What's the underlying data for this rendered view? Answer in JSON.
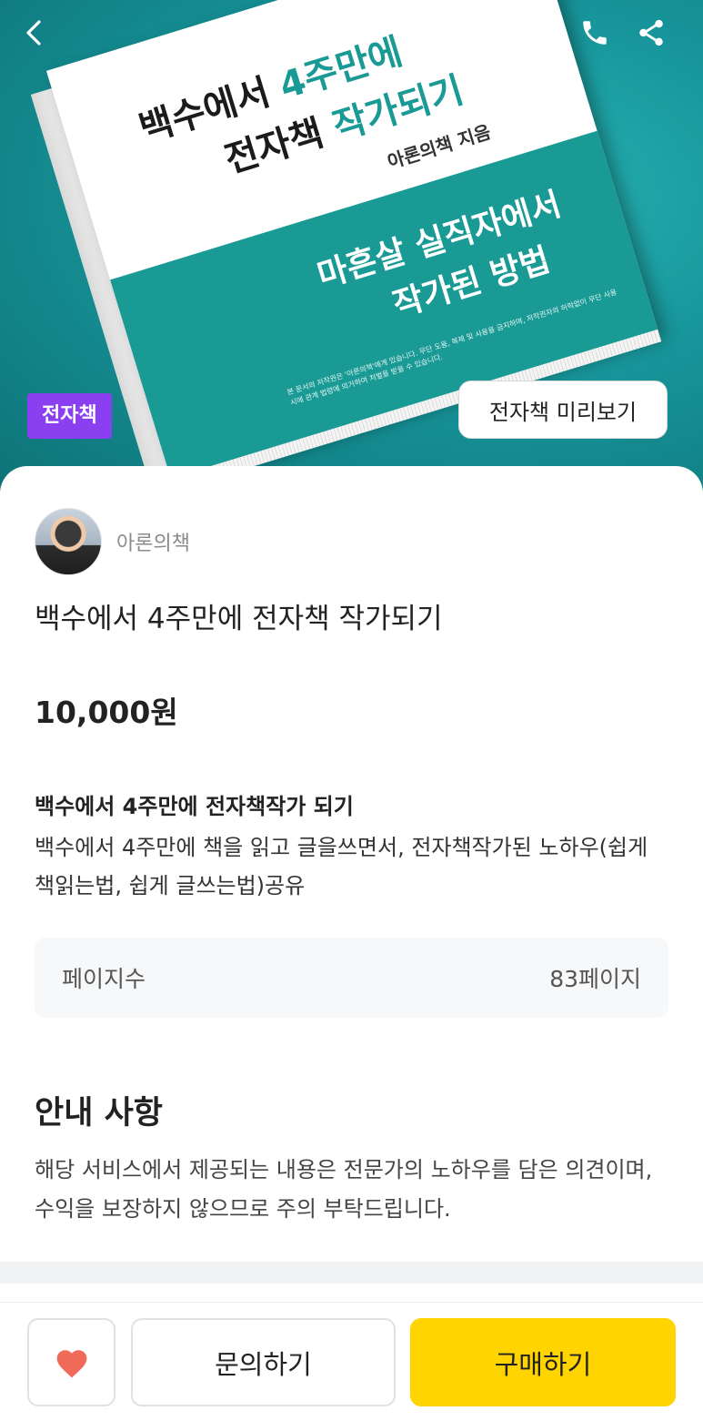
{
  "hero": {
    "cover": {
      "title_line1_prefix": "백수에서 ",
      "title_line1_highlight": "4주만에",
      "title_line2_prefix": "전자책 ",
      "title_line2_highlight": "작가되기",
      "author": "아론의책 지음",
      "subtitle_line1": "마흔살 실직자에서",
      "subtitle_line2": "작가된 방법",
      "fine_print": "본 문서의 저작권은 '아론의책'에게 있습니다. 무단 도용, 복제 및 사용을 금지하며, 저작권자의 허락없이 무단 사용 시에 관계 법령에 의거하여 처벌을 받을 수 있습니다."
    },
    "badge": "전자책",
    "preview_button": "전자책 미리보기",
    "icons": {
      "back": "chevron-left-icon",
      "phone": "phone-icon",
      "share": "share-icon"
    },
    "colors": {
      "teal": "#1a9a95",
      "badge": "#8a3ff0"
    }
  },
  "product": {
    "author": "아론의책",
    "title": "백수에서 4주만에 전자책 작가되기",
    "price": "10,000원",
    "subheading": "백수에서 4주만에 전자책작가 되기",
    "description": "백수에서 4주만에 책을 읽고 글을쓰면서, 전자책작가된 노하우(쉽게 책읽는법, 쉽게 글쓰는법)공유",
    "info": {
      "label": "페이지수",
      "value": "83페이지"
    }
  },
  "notice": {
    "title": "안내 사항",
    "body": "해당 서비스에서 제공되는 내용은 전문가의 노하우를 담은 의견이며, 수익을 보장하지 않으므로 주의 부탁드립니다."
  },
  "actions": {
    "like_icon": "heart-icon",
    "inquiry": "문의하기",
    "buy": "구매하기",
    "colors": {
      "buy": "#ffd400",
      "heart": "#f06a5a"
    }
  }
}
